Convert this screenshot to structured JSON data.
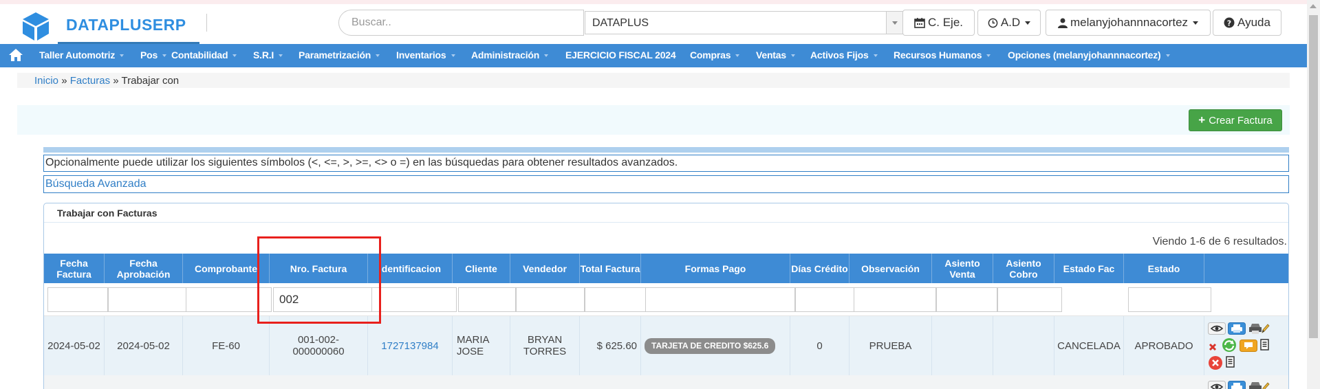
{
  "header": {
    "brand": "DATAPLUSERP",
    "search_placeholder": "Buscar..",
    "company": "DATAPLUS",
    "btn_ejercicio": "C. Eje.",
    "btn_ad": "A.D",
    "user": "melanyjohannnacortez",
    "help": "Ayuda"
  },
  "nav": {
    "items": [
      "Taller Automotriz",
      "Pos",
      "Contabilidad",
      "S.R.I",
      "Parametrización",
      "Inventarios",
      "Administración",
      "EJERCICIO FISCAL 2024",
      "Compras",
      "Ventas",
      "Activos Fijos",
      "Recursos Humanos",
      "Opciones (melanyjohannnacortez)"
    ]
  },
  "breadcrumb": {
    "home": "Inicio",
    "sep": "»",
    "section": "Facturas",
    "current": "Trabajar con"
  },
  "actions": {
    "create": "Crear Factura"
  },
  "info": {
    "symbols": "Opcionalmente puede utilizar los siguientes símbolos (<, <=, >, >=, <> o =) en las búsquedas para obtener resultados avanzados.",
    "advanced": "Búsqueda Avanzada"
  },
  "grid": {
    "title": "Trabajar con Facturas",
    "summary": "Viendo 1-6 de 6 resultados.",
    "columns": [
      "Fecha Factura",
      "Fecha Aprobación",
      "Comprobante",
      "Nro. Factura",
      "Identificacion",
      "Cliente",
      "Vendedor",
      "Total Factura",
      "Formas Pago",
      "Días Crédito",
      "Observación",
      "Asiento Venta",
      "Asiento Cobro",
      "Estado Fac",
      "Estado",
      ""
    ],
    "filters": {
      "nro_factura": "002"
    },
    "rows": [
      {
        "fecha_factura": "2024-05-02",
        "fecha_aprobacion": "2024-05-02",
        "comprobante": "FE-60",
        "nro_factura": "001-002-000000060",
        "identificacion": "1727137984",
        "cliente": "MARIA JOSE",
        "vendedor": "BRYAN TORRES",
        "total": "$ 625.60",
        "formas_pago": "TARJETA DE CREDITO $625.6",
        "dias_credito": "0",
        "observacion": "PRUEBA",
        "asiento_venta": "",
        "asiento_cobro": "",
        "estado_fac": "CANCELADA",
        "estado": "APROBADO"
      }
    ]
  },
  "colors": {
    "brand": "#2f8ee0",
    "nav": "#3e8bd5",
    "success": "#47a447",
    "highlight": "#e8201c"
  }
}
